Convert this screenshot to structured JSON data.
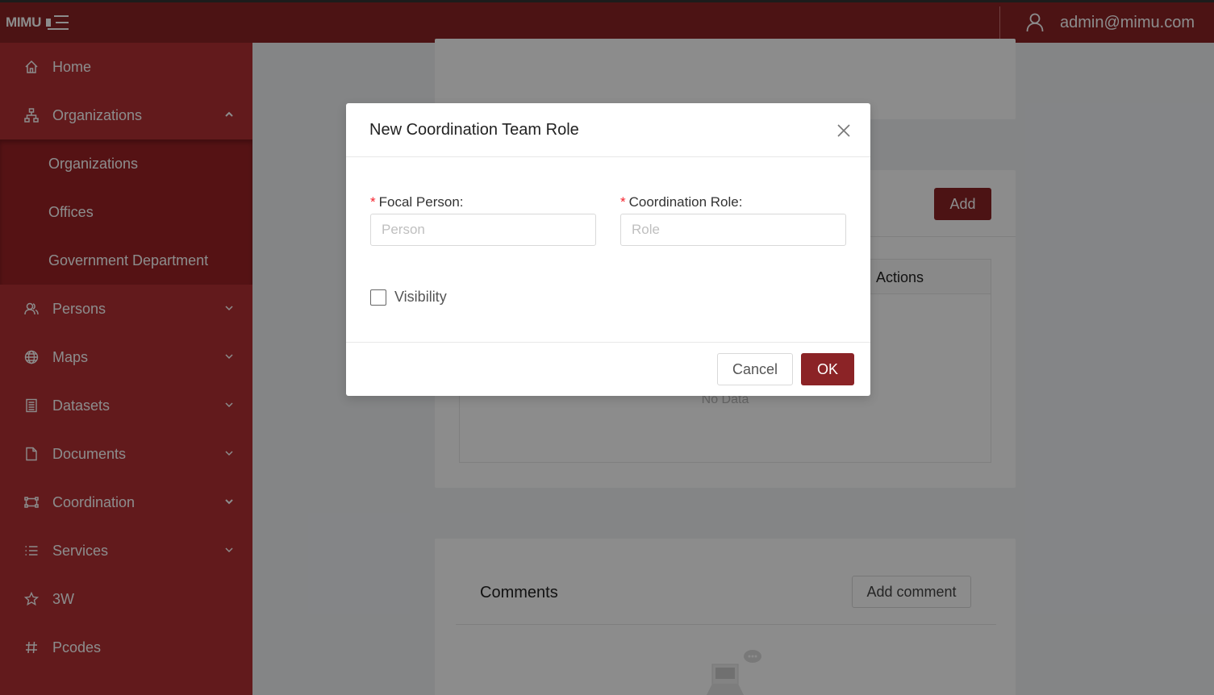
{
  "header": {
    "brand": "MIMU",
    "user_email": "admin@mimu.com"
  },
  "sidebar": {
    "items": [
      {
        "label": "Home",
        "icon": "home-icon"
      },
      {
        "label": "Organizations",
        "icon": "sitemap-icon",
        "expanded": true
      },
      {
        "label": "Persons",
        "icon": "persons-icon"
      },
      {
        "label": "Maps",
        "icon": "globe-icon"
      },
      {
        "label": "Datasets",
        "icon": "dataset-icon"
      },
      {
        "label": "Documents",
        "icon": "document-icon"
      },
      {
        "label": "Coordination",
        "icon": "coordination-icon"
      },
      {
        "label": "Services",
        "icon": "list-icon"
      },
      {
        "label": "3W",
        "icon": "star-icon"
      },
      {
        "label": "Pcodes",
        "icon": "hash-icon"
      }
    ],
    "submenu": [
      "Organizations",
      "Offices",
      "Government Department"
    ]
  },
  "main": {
    "add_label": "Add",
    "table_actions_header": "Actions",
    "no_data": "No Data",
    "comments_title": "Comments",
    "add_comment_label": "Add comment"
  },
  "modal": {
    "title": "New Coordination Team Role",
    "focal_person_label": "Focal Person:",
    "focal_person_placeholder": "Person",
    "coordination_role_label": "Coordination Role:",
    "coordination_role_placeholder": "Role",
    "required_mark": "*",
    "visibility_label": "Visibility",
    "visibility_checked": false,
    "cancel_label": "Cancel",
    "ok_label": "OK"
  },
  "colors": {
    "brand": "#8b2326",
    "sidebar": "#b33034",
    "overlay": "rgba(0,0,0,0.45)"
  }
}
